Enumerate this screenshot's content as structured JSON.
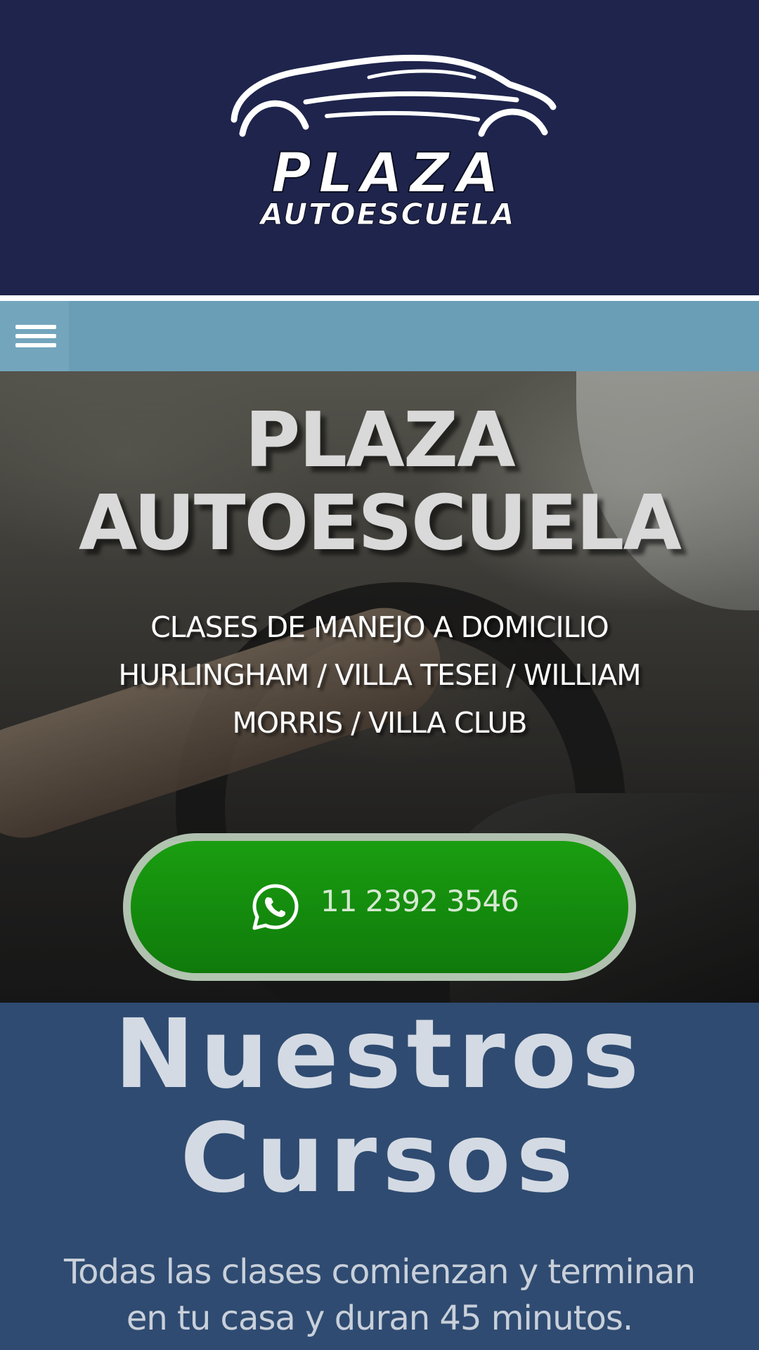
{
  "header": {
    "logo_main": "PLAZA",
    "logo_sub": "AUTOESCUELA",
    "logo_icon": "car-silhouette-icon",
    "background_color": "#1e244c"
  },
  "menu": {
    "toggle_icon": "hamburger-menu-icon",
    "background_color": "#6a9db6"
  },
  "hero": {
    "title_line1": "PLAZA",
    "title_line2": "AUTOESCUELA",
    "subtitle_line1": "CLASES DE MANEJO A DOMICILIO",
    "subtitle_line2": "HURLINGHAM / VILLA TESEI / WILLIAM",
    "subtitle_line3": "MORRIS / VILLA CLUB",
    "whatsapp": {
      "icon": "whatsapp-icon",
      "number": "11 2392 3546",
      "color": "#169010"
    }
  },
  "courses": {
    "title_line1": "Nuestros",
    "title_line2": "Cursos",
    "text_line1": "Todas las clases comienzan y terminan",
    "text_line2": "en tu casa y duran 45 minutos.",
    "background_color": "#2f4b71"
  }
}
